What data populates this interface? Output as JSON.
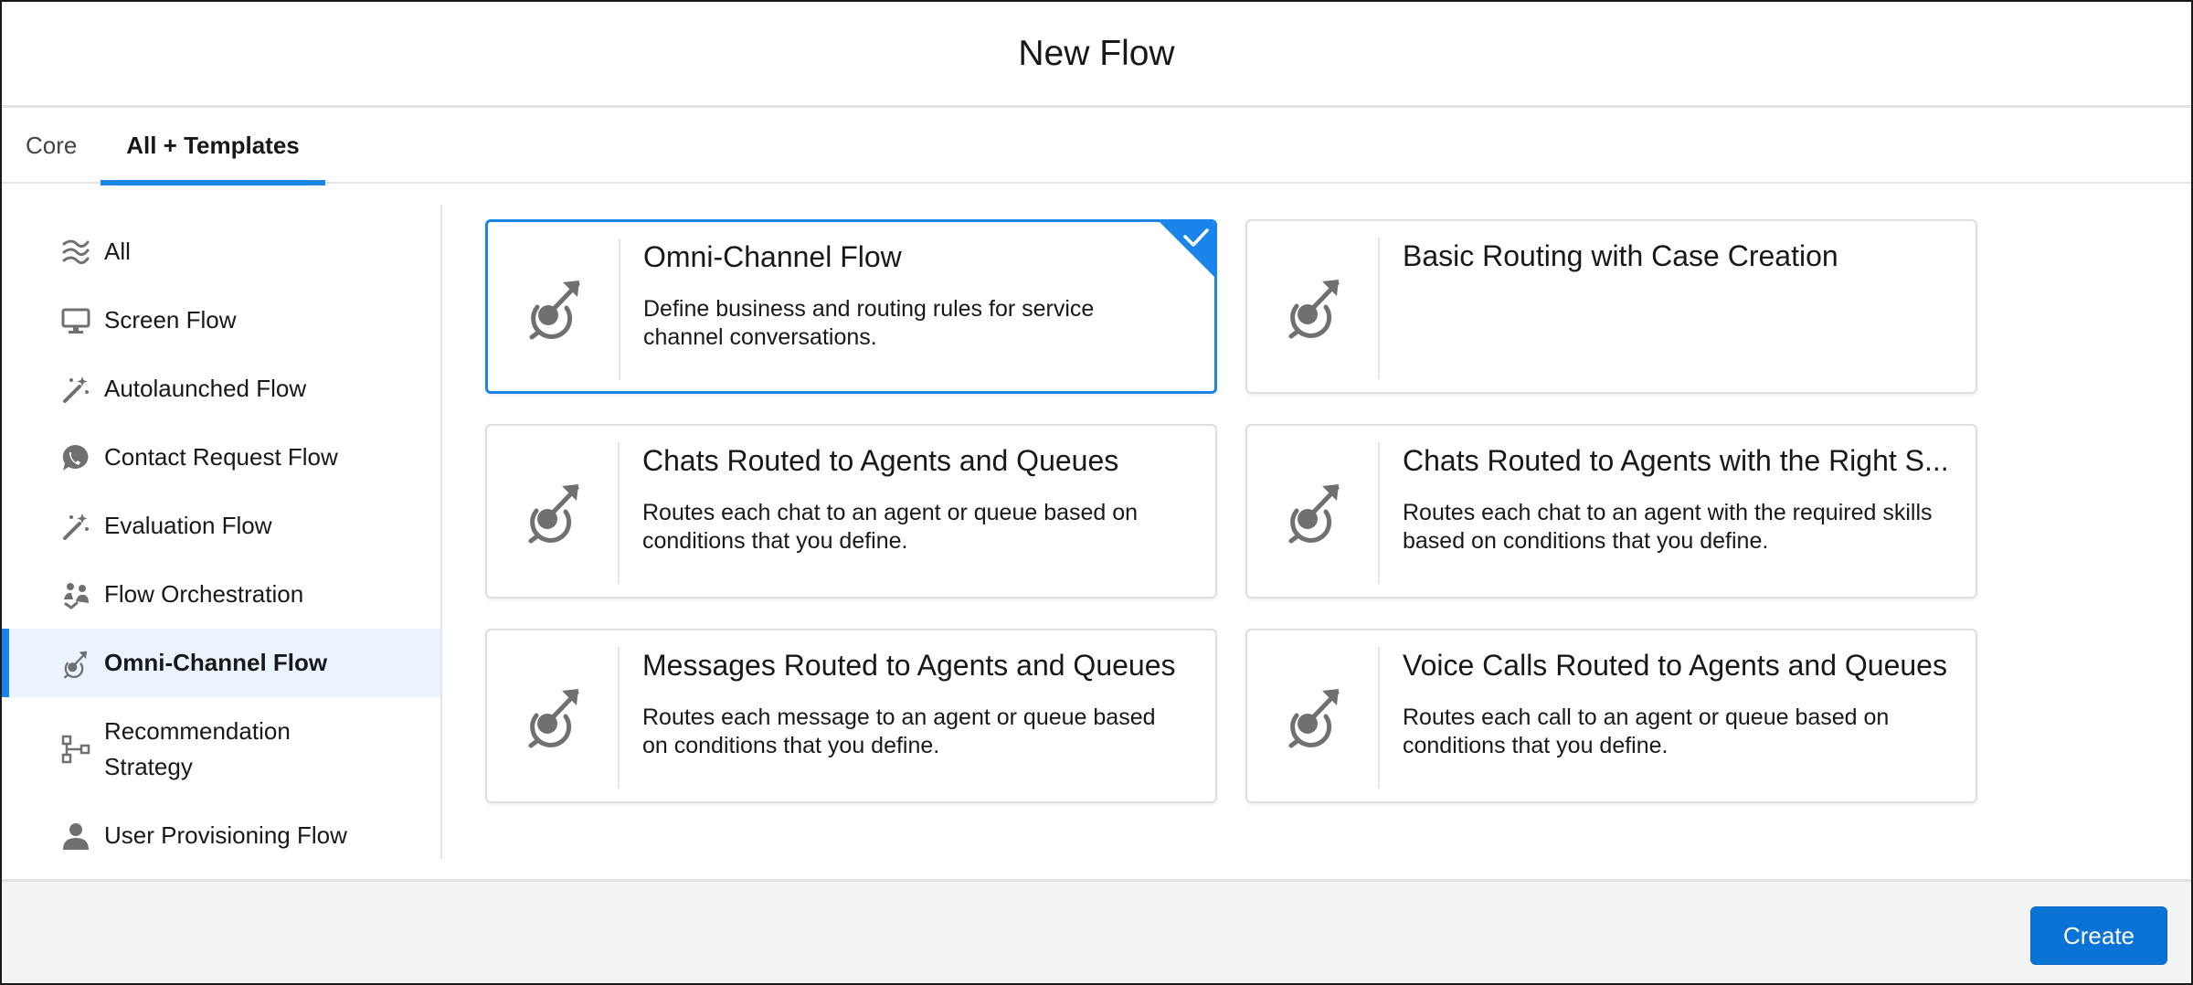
{
  "header": {
    "title": "New Flow"
  },
  "tabs": [
    {
      "label": "Core",
      "active": false
    },
    {
      "label": "All + Templates",
      "active": true
    }
  ],
  "sidebar": {
    "items": [
      {
        "label": "All",
        "icon": "all-flows-icon"
      },
      {
        "label": "Screen Flow",
        "icon": "monitor-icon"
      },
      {
        "label": "Autolaunched Flow",
        "icon": "magic-wand-icon"
      },
      {
        "label": "Contact Request Flow",
        "icon": "contact-request-icon"
      },
      {
        "label": "Evaluation Flow",
        "icon": "magic-wand-icon"
      },
      {
        "label": "Flow Orchestration",
        "icon": "orchestration-icon"
      },
      {
        "label": "Omni-Channel Flow",
        "icon": "omni-channel-icon",
        "selected": true
      },
      {
        "label": "Recommendation Strategy",
        "icon": "hierarchy-icon"
      },
      {
        "label": "User Provisioning Flow",
        "icon": "user-icon"
      }
    ]
  },
  "cards": [
    {
      "title": "Omni-Channel Flow",
      "description": "Define business and routing rules for service channel conversations.",
      "selected": true,
      "icon": "omni-channel-icon"
    },
    {
      "title": "Basic Routing with Case Creation",
      "description": "",
      "selected": false,
      "icon": "omni-channel-icon"
    },
    {
      "title": "Chats Routed to Agents and Queues",
      "description": "Routes each chat to an agent or queue based on conditions that you define.",
      "selected": false,
      "icon": "omni-channel-icon"
    },
    {
      "title": "Chats Routed to Agents with the Right S...",
      "description": "Routes each chat to an agent with the required skills based on conditions that you define.",
      "selected": false,
      "icon": "omni-channel-icon"
    },
    {
      "title": "Messages Routed to Agents and Queues",
      "description": "Routes each message to an agent or queue based on conditions that you define.",
      "selected": false,
      "icon": "omni-channel-icon"
    },
    {
      "title": "Voice Calls Routed to Agents and Queues",
      "description": "Routes each call to an agent or queue based on conditions that you define.",
      "selected": false,
      "icon": "omni-channel-icon"
    }
  ],
  "footer": {
    "create_label": "Create"
  },
  "colors": {
    "accent": "#1b84ea",
    "button": "#0b72d6",
    "icon": "#707070"
  }
}
